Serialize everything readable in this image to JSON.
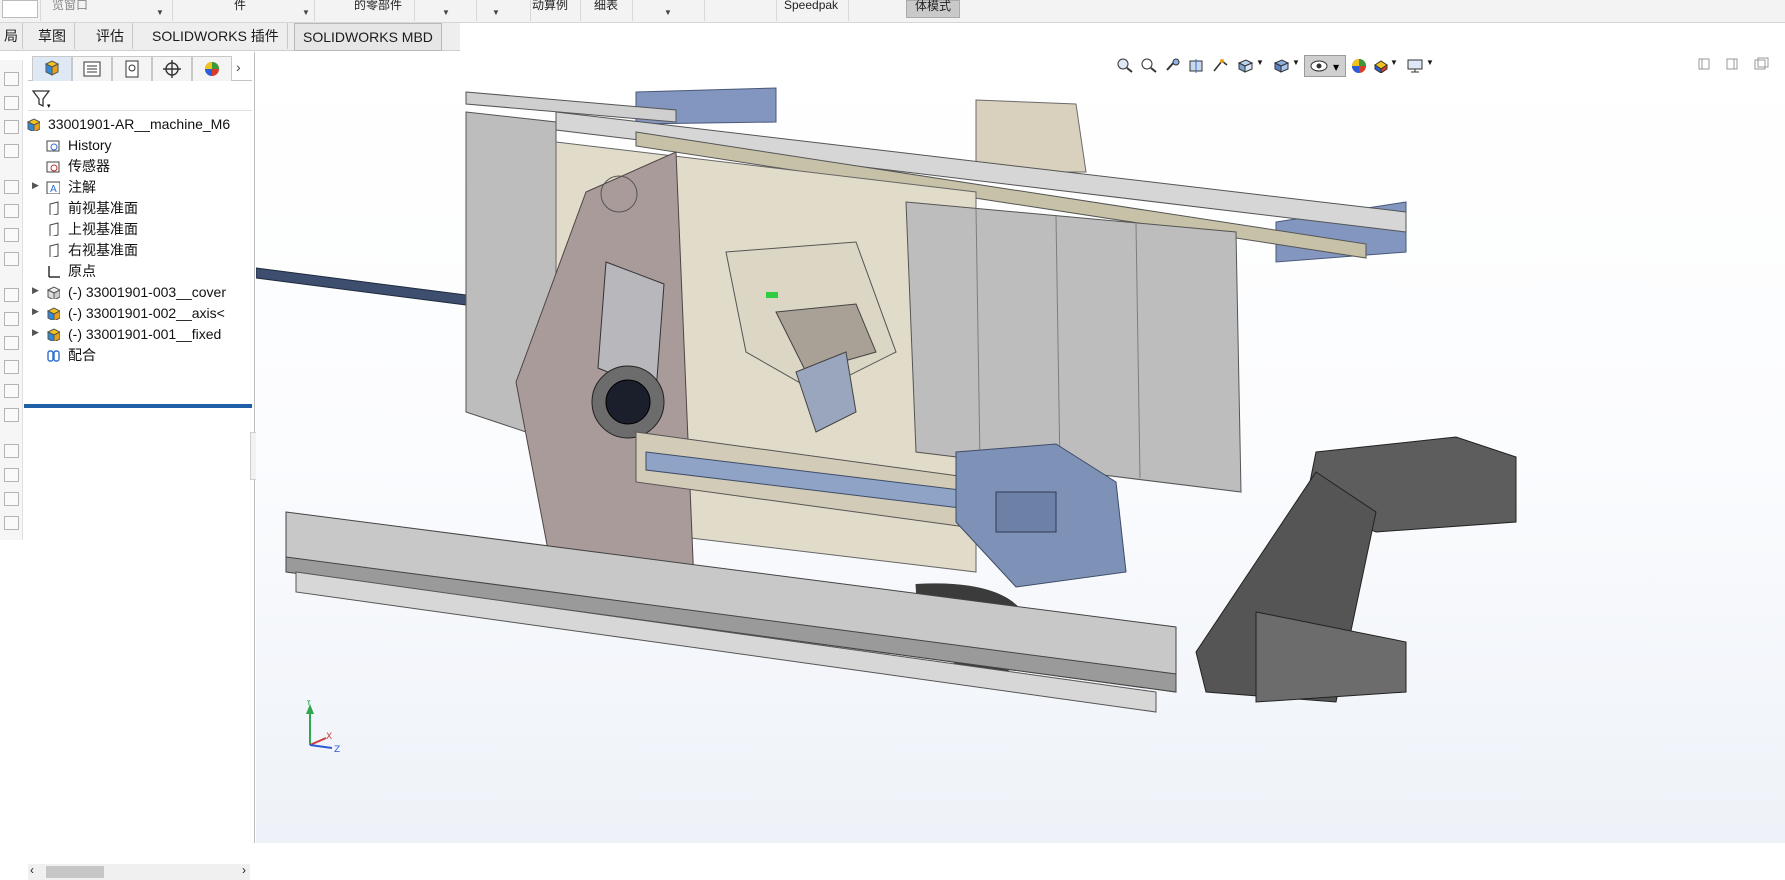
{
  "ribbon": {
    "items": [
      "览窗口",
      "件",
      "的零部件",
      "动算例",
      "细表",
      "Speedpak",
      "体模式"
    ]
  },
  "tabs": [
    "局",
    "草图",
    "评估",
    "SOLIDWORKS 插件",
    "SOLIDWORKS MBD"
  ],
  "feature_tree": {
    "root": "33001901-AR__machine_M6",
    "items": [
      {
        "label": "History",
        "icon": "history-icon",
        "expandable": false
      },
      {
        "label": "传感器",
        "icon": "sensor-icon",
        "expandable": false
      },
      {
        "label": "注解",
        "icon": "annotation-icon",
        "expandable": true
      },
      {
        "label": "前视基准面",
        "icon": "plane-icon",
        "expandable": false
      },
      {
        "label": "上视基准面",
        "icon": "plane-icon",
        "expandable": false
      },
      {
        "label": "右视基准面",
        "icon": "plane-icon",
        "expandable": false
      },
      {
        "label": "原点",
        "icon": "origin-icon",
        "expandable": false
      },
      {
        "label": "(-) 33001901-003__cover",
        "icon": "subassembly-icon",
        "expandable": true
      },
      {
        "label": "(-) 33001901-002__axis<",
        "icon": "subassembly-icon",
        "expandable": true
      },
      {
        "label": "(-) 33001901-001__fixed",
        "icon": "subassembly-icon",
        "expandable": true
      },
      {
        "label": "配合",
        "icon": "mates-icon",
        "expandable": false
      }
    ]
  },
  "colors": {
    "accent": "#1e5fa8",
    "tab_bg": "#eeeeee",
    "panel_border": "#bdbdbd",
    "machine_beige": "#d8d0b8",
    "machine_gray": "#a9a9a9",
    "machine_mauve": "#a89a98",
    "machine_blue": "#7f93b8",
    "chip_conveyor": "#555555"
  },
  "triad": {
    "x": "X",
    "y": "Y",
    "z": "Z"
  }
}
